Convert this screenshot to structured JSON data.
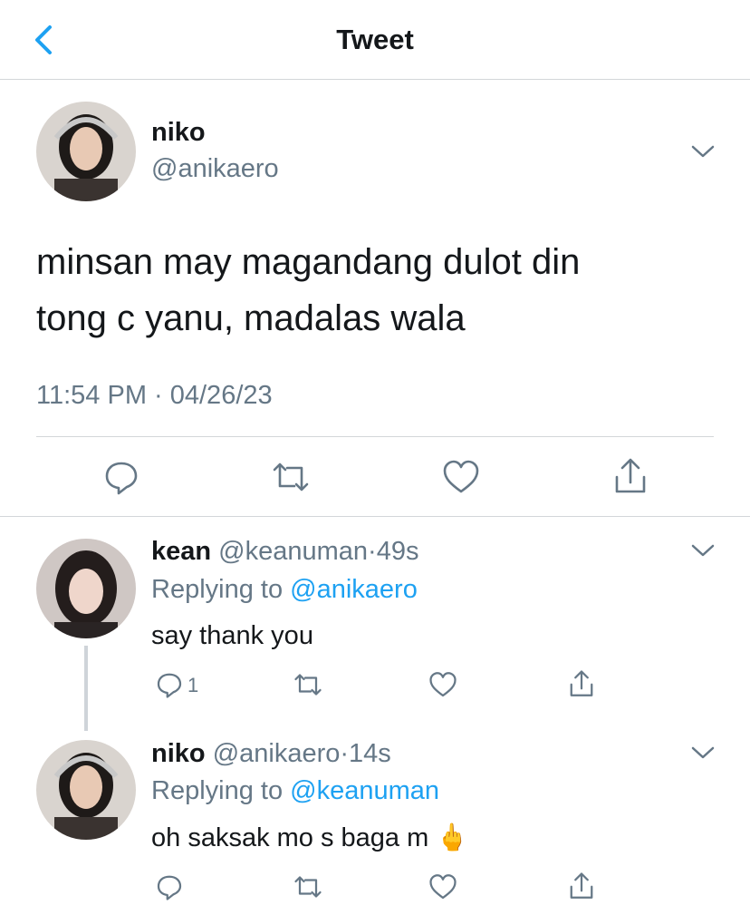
{
  "header": {
    "title": "Tweet",
    "back_icon": "chevron-left-icon",
    "accent": "#1da1f2"
  },
  "tweet": {
    "name": "niko",
    "handle": "@anikaero",
    "text_line1": "minsan may magandang dulot din",
    "text_line2": "tong c yanu, madalas wala",
    "timestamp": "11:54 PM · 04/26/23"
  },
  "replies": [
    {
      "name": "kean",
      "handle": "@keanuman",
      "time": "·49s",
      "replying_label": "Replying to",
      "replying_to": "@anikaero",
      "text": "say thank you",
      "reply_count": "1"
    },
    {
      "name": "niko",
      "handle": "@anikaero",
      "time": "·14s",
      "replying_label": "Replying to",
      "replying_to": "@keanuman",
      "text": "oh saksak mo s baga m",
      "emoji": "🖕"
    }
  ],
  "colors": {
    "text": "#14171a",
    "muted": "#657786",
    "link": "#1da1f2",
    "border": "#d3d6d9"
  }
}
